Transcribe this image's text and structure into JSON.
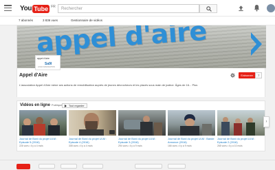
{
  "masthead": {
    "logo_you": "You",
    "logo_tube": "Tube",
    "logo_locale": "FR",
    "search_placeholder": "Rechercher"
  },
  "subbar": {
    "subscribers": "7 abonnés",
    "views": "3 836 vues",
    "manager": "Gestionnaire de vidéos"
  },
  "banner": {
    "text": "appel d'aire"
  },
  "logo_box": {
    "line1": "appel d'aire",
    "line2": "Sa9l",
    "line3": "LOGO ASSOCIATION"
  },
  "channel": {
    "name": "Appel d'Aire",
    "subscribe_label": "S'abonner",
    "subscribe_count": "7",
    "description": "L'association Appel d'Aire mène ses actions de remobilisation auprès de jeunes décrocheurs et les placés sous main de justice. Âges de 16... Plus"
  },
  "shelf": {
    "title": "Vidéos en ligne",
    "visibility": "Publique",
    "play_all": "Tout regarder",
    "videos": [
      {
        "title": "Journal de Bord du projet ULM : Episode 5 (2016)",
        "meta": "226 vues • il y a 4 mois"
      },
      {
        "title": "Journal de Bord du projet ULM : Episode 4 (2016)",
        "meta": "308 vues • il y a 4 mois"
      },
      {
        "title": "Journal de Bord du projet ULM : Episode 3 (2016)",
        "meta": "294 vues • il y a 9 mois"
      },
      {
        "title": "Journal de Bord du projet ULM : Bande Annonce (2016)",
        "meta": "166 vues • il y a 9 mois"
      },
      {
        "title": "Journal de Bord du projet ULM : Episode 2 (2016)",
        "meta": "265 vues • il y a 10 mois"
      }
    ]
  },
  "colors": {
    "brand_red": "#e62117",
    "banner_blue": "#2f8fd6",
    "link_blue": "#167ac6"
  },
  "icons": [
    "menu-icon",
    "search-icon",
    "upload-icon",
    "bell-icon",
    "gear-icon",
    "chevron-right-icon"
  ]
}
